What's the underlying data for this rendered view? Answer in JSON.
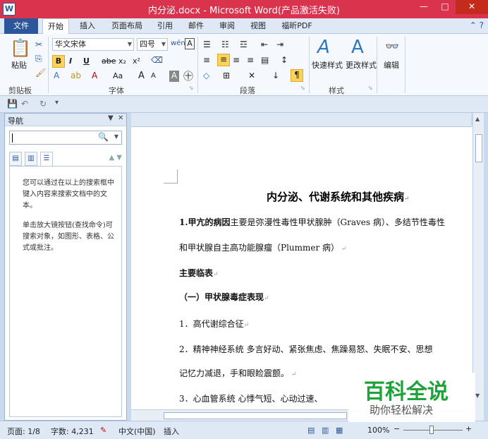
{
  "window": {
    "app_icon": "W",
    "title": "内分泌.docx - Microsoft Word(产品激活失败)",
    "controls": [
      "—",
      "□",
      "✕"
    ]
  },
  "tabs": [
    "文件",
    "开始",
    "插入",
    "页面布局",
    "引用",
    "邮件",
    "审阅",
    "视图",
    "福昕PDF"
  ],
  "ribbon": {
    "clipboard": {
      "paste": "粘贴",
      "label": "剪贴板"
    },
    "font": {
      "font_name": "华文宋体",
      "font_size": "四号",
      "label": "字体",
      "bold": "B",
      "italic": "I",
      "underline": "U",
      "strike": "abe",
      "subscript": "x₂",
      "superscript": "x²",
      "grow": "A",
      "shrink": "A",
      "case": "Aa",
      "char_border": "A"
    },
    "paragraph": {
      "label": "段落"
    },
    "styles": {
      "quick": "快速样式",
      "change": "更改样式",
      "label": "样式"
    },
    "editing": {
      "label": "编辑"
    }
  },
  "nav": {
    "title": "导航",
    "search_value": "",
    "message1": "您可以通过在以上的搜索框中键入内容来搜索文档中的文本。",
    "message2": "单击放大镜按钮(查找命令)可搜索对象，如图形、表格、公式或批注。"
  },
  "document": {
    "title": "内分泌、代谢系统和其他疾病",
    "lines": [
      {
        "bold": "1.甲亢的病因",
        "text": "主要是弥漫性毒性甲状腺肿（Graves 病）、多结节性毒性"
      },
      {
        "bold": "",
        "text": "和甲状腺自主高功能腺瘤（Plummer 病）"
      },
      {
        "bold": "主要临表",
        "text": ""
      },
      {
        "bold": "（一）甲状腺毒症表现",
        "text": ""
      },
      {
        "bold": "",
        "text": "1．高代谢综合征"
      },
      {
        "bold": "",
        "text": "2．精神神经系统   多言好动、紧张焦虑、焦躁易怒、失眠不安、思想"
      },
      {
        "bold": "",
        "text": "记忆力减退，手和眼睑震颤。"
      },
      {
        "bold": "",
        "text": "3．心血管系统   心悸气短、心动过速、"
      }
    ]
  },
  "status": {
    "page": "页面: 1/8",
    "words": "字数: 4,231",
    "lang": "中文(中国)",
    "mode": "插入",
    "zoom": "100%",
    "zoom_minus": "−",
    "zoom_plus": "+"
  },
  "watermark": {
    "title": "百科全说",
    "subtitle": "助你轻松解决"
  }
}
